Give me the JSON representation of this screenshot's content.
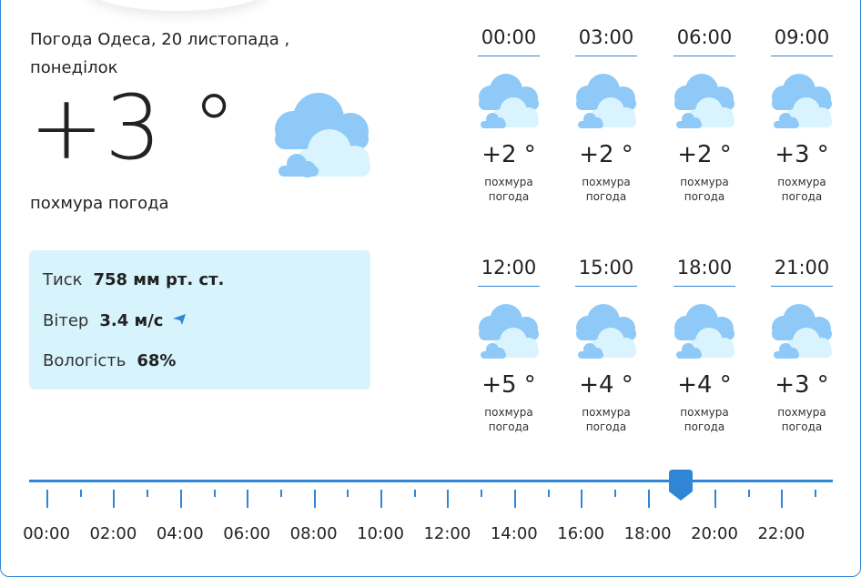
{
  "header": {
    "title": "Погода Одеса, 20 листопада , понеділок"
  },
  "current": {
    "temperature": "+3 °",
    "condition": "похмура погода",
    "icon": "cloud-icon"
  },
  "details": {
    "pressure_label": "Тиск",
    "pressure_value": "758 мм рт. ст.",
    "wind_label": "Вітер",
    "wind_value": "3.4 м/с",
    "wind_icon": "wind-direction-arrow-icon",
    "humidity_label": "Вологість",
    "humidity_value": "68%"
  },
  "hourly": [
    {
      "time": "00:00",
      "temp": "+2 °",
      "desc": "похмура погода",
      "icon": "cloud-icon"
    },
    {
      "time": "03:00",
      "temp": "+2 °",
      "desc": "похмура погода",
      "icon": "cloud-icon"
    },
    {
      "time": "06:00",
      "temp": "+2 °",
      "desc": "похмура погода",
      "icon": "cloud-icon"
    },
    {
      "time": "09:00",
      "temp": "+3 °",
      "desc": "похмура погода",
      "icon": "cloud-icon"
    },
    {
      "time": "12:00",
      "temp": "+5 °",
      "desc": "похмура погода",
      "icon": "cloud-icon"
    },
    {
      "time": "15:00",
      "temp": "+4 °",
      "desc": "похмура погода",
      "icon": "cloud-icon"
    },
    {
      "time": "18:00",
      "temp": "+4 °",
      "desc": "похмура погода",
      "icon": "cloud-icon"
    },
    {
      "time": "21:00",
      "temp": "+3 °",
      "desc": "похмура погода",
      "icon": "cloud-icon"
    }
  ],
  "timeline": {
    "labels": [
      "00:00",
      "02:00",
      "04:00",
      "06:00",
      "08:00",
      "10:00",
      "12:00",
      "14:00",
      "16:00",
      "18:00",
      "20:00",
      "22:00"
    ],
    "selected_hour": 19
  },
  "colors": {
    "accent": "#2f86d6",
    "info_bg": "#d7f4fd",
    "cloud_back": "#8ec9f7",
    "cloud_front": "#d9f4ff"
  }
}
